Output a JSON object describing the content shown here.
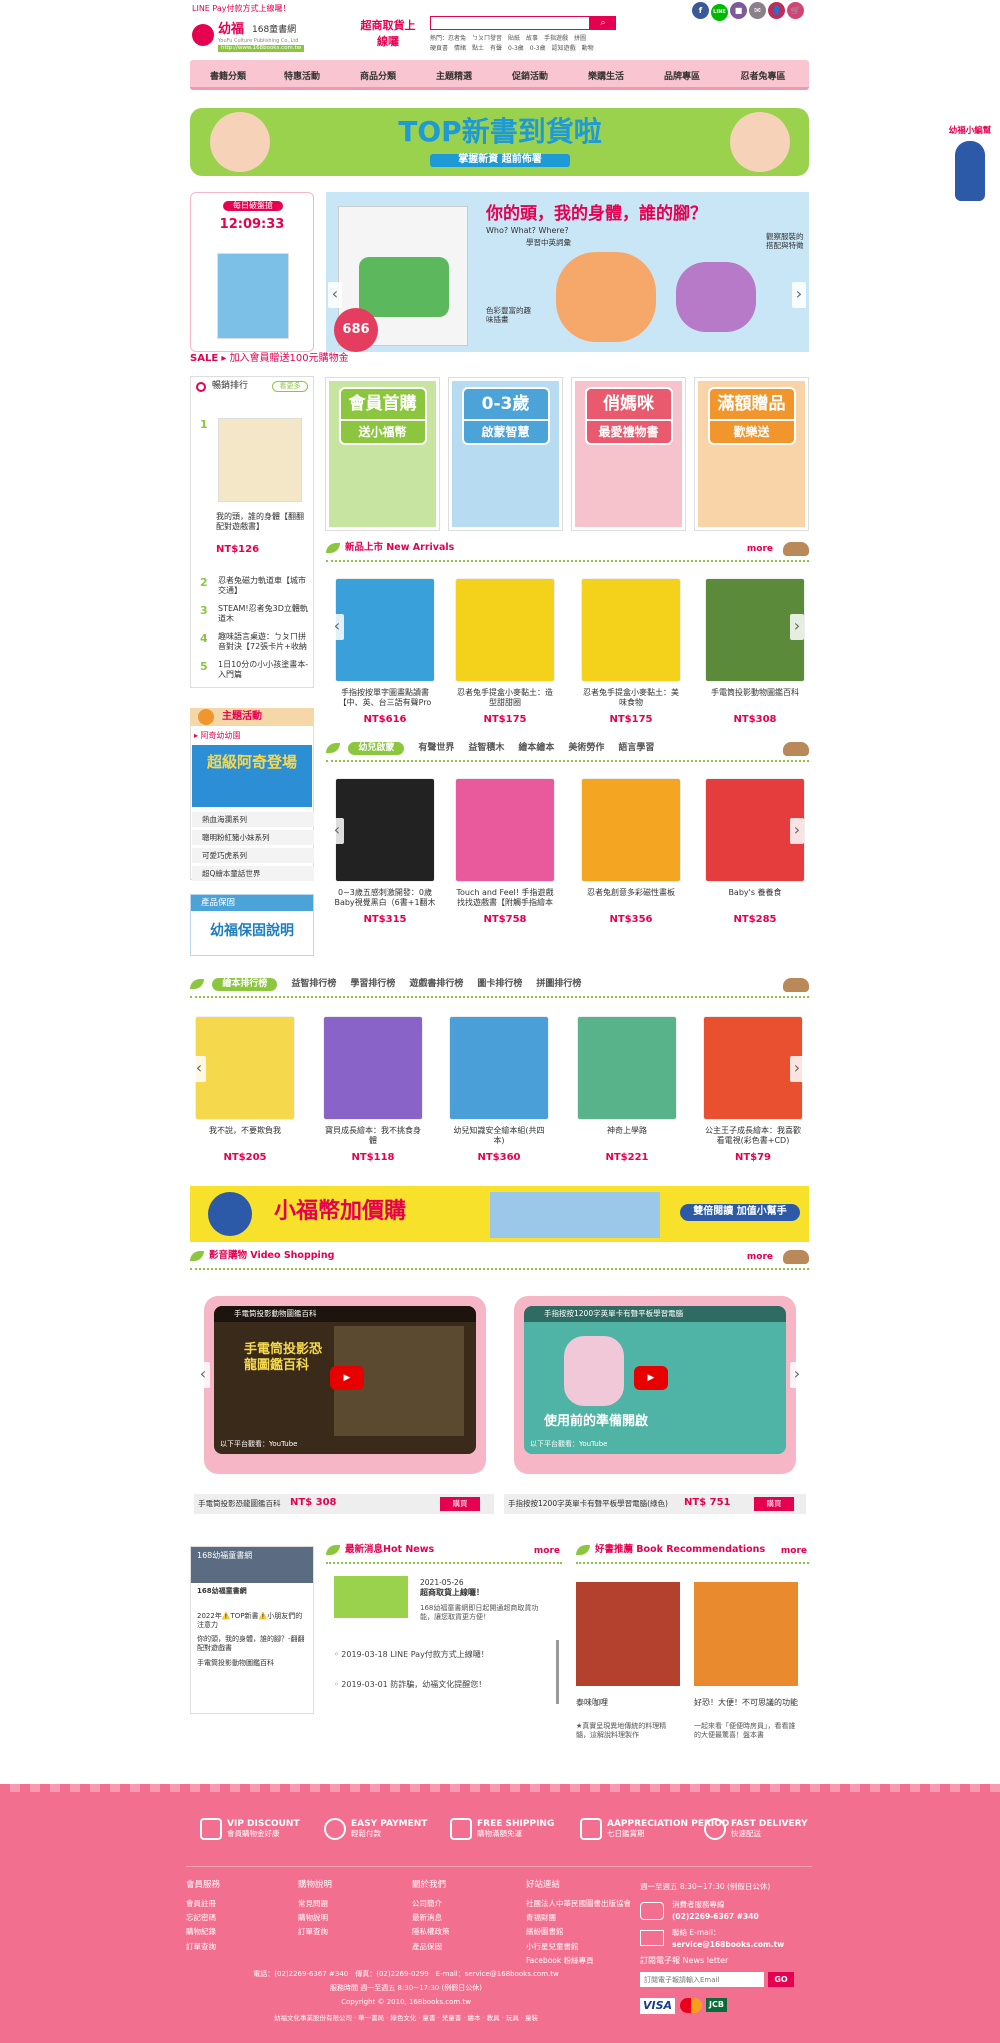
{
  "topbar": {
    "notice": "LINE Pay付款方式上線囉！",
    "social": [
      "f",
      "LINE",
      "■",
      "✉",
      "👤",
      "🛒"
    ]
  },
  "logo": {
    "brand": "幼福",
    "name": "168童書網",
    "tagline": "YouFu Culture Publishing Co.,Ltd",
    "url": "http://www.168books.com.tw",
    "badge": "超商取貨上線囉"
  },
  "search": {
    "placeholder": "",
    "hot_label": "熱門：",
    "hot_row1": "忍者兔　ㄅㄆㄇ發音　貼紙　故事　手指遊戲　拼圖",
    "hot_row2": "硬頁書　情緒　點土　有聲　0-3歲　0-3歲　認知遊戲　動物"
  },
  "nav": [
    "書籍分類",
    "特惠活動",
    "商品分類",
    "主題精選",
    "促銷活動",
    "樂購生活",
    "品牌專區",
    "忍者兔專區"
  ],
  "banner": {
    "title": "TOP新書到貨啦",
    "subtitle": "掌握新資 超前佈署"
  },
  "side_float": {
    "label": "幼福小編幫"
  },
  "daily": {
    "label": "每日破盤搶",
    "time": "12:09:33",
    "badge": "686"
  },
  "hero": {
    "title": "你的頭，我的身體，誰的腳？",
    "subtitle": "Who? What? Where?",
    "point1": "學習中英詞彙",
    "point2": "觀察服裝的搭配與特徵",
    "point3": "色彩豐富的趣味插畫"
  },
  "sale": {
    "tag": "SALE",
    "text": "加入會員贈送100元購物金"
  },
  "ranking": {
    "title": "暢銷排行",
    "more": "看更多",
    "first": {
      "name": "我的頭，誰的身體【翻翻配對遊戲書】",
      "price": "NT$126"
    },
    "items": [
      {
        "n": "2",
        "t": "忍者兔磁力軌道車【城市交通】"
      },
      {
        "n": "3",
        "t": "STEAM!忍者兔3D立體軌道木"
      },
      {
        "n": "4",
        "t": "趣味語言桌遊：ㄅㄆㄇ拼音對決【72張卡片+收納"
      },
      {
        "n": "5",
        "t": "1日10分の小小孩塗畫本-入門篇"
      }
    ]
  },
  "promos": [
    {
      "title": "會員首購",
      "sub": "送小福幣",
      "color": "#8cc63f"
    },
    {
      "title": "0-3歲",
      "sub": "啟蒙智慧",
      "color": "#4ba3d8"
    },
    {
      "title": "俏媽咪",
      "sub": "最愛禮物書",
      "color": "#e95a6f"
    },
    {
      "title": "滿額贈品",
      "sub": "歡樂送",
      "color": "#f0962d"
    }
  ],
  "new_arrivals": {
    "title": "新品上市 New Arrivals",
    "more": "more",
    "items": [
      {
        "name": "手指按按單字圖畫點讀書【中、英、台三語有聲Pro",
        "price": "NT$616",
        "color": "#3aa0d9"
      },
      {
        "name": "忍者兔手提盒小麥黏土：造型甜甜圈",
        "price": "NT$175",
        "color": "#f4d21c"
      },
      {
        "name": "忍者兔手提盒小麥黏土：美味食物",
        "price": "NT$175",
        "color": "#f4d21c"
      },
      {
        "name": "手電筒投影動物圖鑑百科",
        "price": "NT$308",
        "color": "#5a8a3a"
      }
    ]
  },
  "category_tabs": {
    "tabs": [
      "幼兒啟蒙",
      "有聲世界",
      "益智積木",
      "繪本繪本",
      "美術勞作",
      "語言學習"
    ],
    "items": [
      {
        "name": "0~3歲五感刺激開發：0歲Baby視覺黑白（6書+1翻木",
        "price": "NT$315",
        "color": "#222"
      },
      {
        "name": "Touch and Feel! 手指遊戲找找遊戲書【附觸手指繪本",
        "price": "NT$758",
        "color": "#e85a9c"
      },
      {
        "name": "忍者兔創意多彩磁性畫板",
        "price": "NT$356",
        "color": "#f4a623"
      },
      {
        "name": "Baby's 養養食",
        "price": "NT$285",
        "color": "#e53d3d"
      }
    ]
  },
  "picturebook_tabs": {
    "tabs": [
      "繪本排行榜",
      "益智排行榜",
      "學習排行榜",
      "遊戲書排行榜",
      "圖卡排行榜",
      "拼圖排行榜"
    ],
    "items": [
      {
        "name": "我不說，不要欺負我",
        "price": "NT$205",
        "color": "#f6d84c"
      },
      {
        "name": "寶貝成長繪本：我不挑食身體",
        "price": "NT$118",
        "color": "#8a63c8"
      },
      {
        "name": "幼兒知識安全繪本組(共四本)",
        "price": "NT$360",
        "color": "#4b9fd9"
      },
      {
        "name": "神奇上學路",
        "price": "NT$221",
        "color": "#59b38a"
      },
      {
        "name": "公主王子成長繪本：我喜歡看電視(彩色書+CD)",
        "price": "NT$79",
        "color": "#e8502f"
      }
    ]
  },
  "bonus_banner": {
    "title": "小福幣加價購",
    "sub": "雙倍閱讀 加值小幫手"
  },
  "video": {
    "title": "影音購物 Video Shopping",
    "more": "more",
    "items": [
      {
        "caption": "手電筒投影動物圖鑑百科",
        "overlay": "手電筒投影恐龍圖鑑百科",
        "name": "手電筒投影恐龍圖鑑百科",
        "price": "NT$ 308",
        "buy": "購買",
        "watch": "以下平台觀看：YouTube"
      },
      {
        "caption": "手指按按1200字英單卡有聲平板學習電腦",
        "overlay": "使用前的準備開啟",
        "name": "手指按按1200字英單卡有聲平板學習電腦(綠色)",
        "price": "NT$ 751",
        "buy": "購買",
        "watch": "以下平台觀看：YouTube"
      }
    ]
  },
  "theme": {
    "title": "主題活動",
    "current": "阿奇幼幼園",
    "banner": "超級阿奇登場",
    "items": [
      "熱血海瀾系列",
      "聰明粉紅豬小妹系列",
      "可愛巧虎系列",
      "超Q繪本童話世界"
    ]
  },
  "warranty": {
    "title": "產品保固",
    "text": "幼福保固說明"
  },
  "fb": {
    "page": "168幼福童書網",
    "like": "168幼福童書網",
    "post1": "2022年⚠️TOP新書⚠️小朋友們的注意力",
    "post2": "你的頭，我的身體，誰的腳？-翻翻配對遊戲書",
    "post3": "手電筒投影動物圖鑑百科"
  },
  "news": {
    "title": "最新消息Hot News",
    "more": "more",
    "top_date": "2021-05-26",
    "top_title": "超商取貨上線囉！",
    "top_desc": "168幼福童書網即日起開通超商取貨功能，讓您取貨更方便！",
    "items": [
      "2019-03-18 LINE Pay付款方式上線囉！",
      "2019-03-01 防詐騙，幼福文化提醒您！"
    ]
  },
  "recommend": {
    "title": "好書推薦 Book Recommendations",
    "more": "more",
    "items": [
      {
        "name": "泰味咖哩",
        "desc": "★真實呈現異地傳統的料理精髓，這解說料理製作",
        "color": "#b4412d"
      },
      {
        "name": "好恐！大便！不可思議的功能",
        "desc": "一起來看「便便時房員」，看看誰的大便最驚喜！盤本書",
        "color": "#e88a2d"
      }
    ]
  },
  "services": [
    {
      "en": "VIP DISCOUNT",
      "zh": "會員購物金好康"
    },
    {
      "en": "EASY PAYMENT",
      "zh": "輕鬆付款"
    },
    {
      "en": "FREE SHIPPING",
      "zh": "購物滿額免運"
    },
    {
      "en": "AAPPRECIATION PERIOD",
      "zh": "七日鑑賞期"
    },
    {
      "en": "FAST DELIVERY",
      "zh": "快速配送"
    }
  ],
  "footer": {
    "col1": {
      "h": "會員服務",
      "items": [
        "會員註冊",
        "忘記密碼",
        "購物紀錄",
        "訂單查詢"
      ]
    },
    "col2": {
      "h": "購物說明",
      "items": [
        "常見問題",
        "購物說明",
        "訂單查詢"
      ]
    },
    "col3": {
      "h": "關於我們",
      "items": [
        "公司簡介",
        "最新消息",
        "隱私權政策",
        "產品保固"
      ]
    },
    "col4": {
      "h": "好站連結",
      "items": [
        "社團法人中華民國圖書出版協會",
        "青福財團",
        "繽紛圖書館",
        "小行星兒童書館",
        "Facebook 粉絲專頁"
      ]
    },
    "hours": "週一至週五 8:30~17:30 (例假日公休)",
    "phone_label": "消費者服務專線",
    "phone": "(02)2269-6367 #340",
    "email_label": "聯絡 E-mail：",
    "email": "service@168books.com.tw",
    "epaper": "訂閱電子報 News letter",
    "epaper_placeholder": "訂閱電子報請輸入Email",
    "go": "GO",
    "contact1": "電話：(02)2269-6367 #340　傳真：(02)2269-0299　E-mail：service@168books.com.tw",
    "contact2": "服務時間 週一至週五 8:30~17:30 (例假日公休)",
    "copyright": "Copyright © 2010, 168books.com.tw",
    "group": "幼福文化事業股份有限公司 · 華一書局 · 綠色文化 · 童書 · 兒童書 · 繪本 · 教具 · 玩具 · 童裝",
    "payments": [
      "VISA",
      "MasterCard",
      "JCB"
    ]
  },
  "colors": {
    "primary": "#e60050",
    "green": "#8cc63f",
    "footer": "#f36f90",
    "nav": "#f9c5d0"
  }
}
